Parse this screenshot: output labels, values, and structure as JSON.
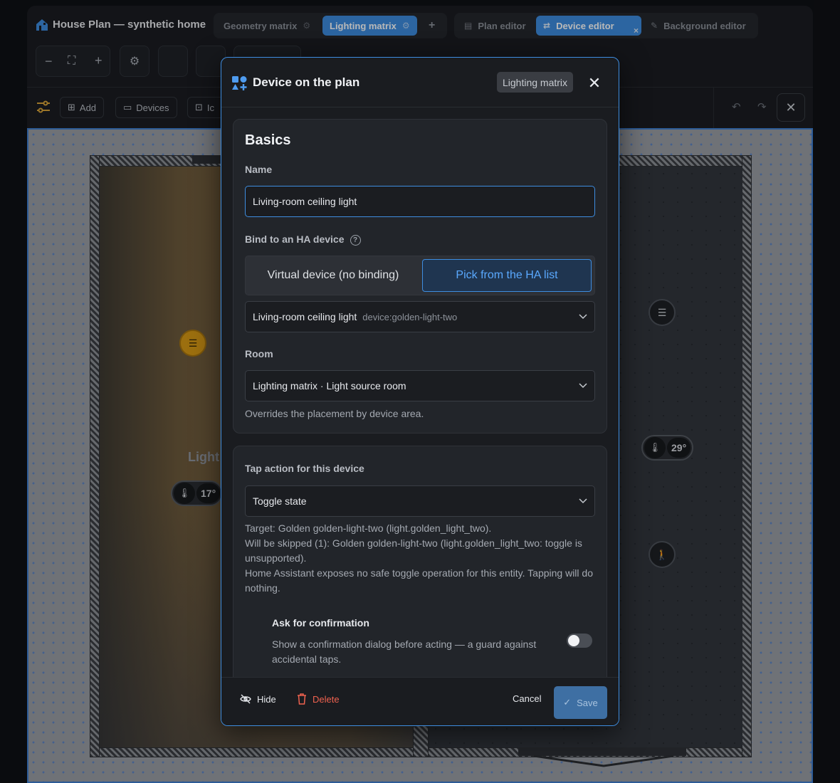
{
  "app": {
    "title": "House Plan — synthetic home",
    "plan_tabs": [
      {
        "label": "Geometry matrix",
        "active": false
      },
      {
        "label": "Lighting matrix",
        "active": true
      }
    ],
    "add_tab": "+",
    "editor_tabs": [
      {
        "label": "Plan editor",
        "active": false
      },
      {
        "label": "Device editor",
        "active": true
      },
      {
        "label": "Background editor",
        "active": false
      }
    ],
    "accent_color": "#3e8de0"
  },
  "toolbar": {
    "zoom_out": "−",
    "zoom_in": "+",
    "chips": [
      {
        "label": "Add",
        "icon": "plus-square-icon"
      },
      {
        "label": "Devices",
        "icon": "devices-icon"
      },
      {
        "label": "Ic",
        "icon": "icons-icon"
      }
    ]
  },
  "plan": {
    "room_label": "Light",
    "temp_left": "17°",
    "temp_right": "29°"
  },
  "dialog": {
    "title": "Device on the plan",
    "tag": "Lighting matrix",
    "basics": {
      "heading": "Basics",
      "name_label": "Name",
      "name_value": "Living-room ceiling light",
      "bind_label": "Bind to an HA device",
      "bind_help": "?",
      "bind_options": [
        "Virtual device (no binding)",
        "Pick from the HA list"
      ],
      "bind_selected_index": 1,
      "device_value": "Living-room ceiling light",
      "device_id": "device:golden-light-two",
      "room_label": "Room",
      "room_value": "Lighting matrix · Light source room",
      "room_hint": "Overrides the placement by device area."
    },
    "tap": {
      "label": "Tap action for this device",
      "value": "Toggle state",
      "target": "Target: Golden golden-light-two (light.golden_light_two).",
      "skipped": "Will be skipped (1): Golden golden-light-two (light.golden_light_two: toggle is unsupported).",
      "note": "Home Assistant exposes no safe toggle operation for this entity. Tapping will do nothing.",
      "confirm_title": "Ask for confirmation",
      "confirm_desc": "Show a confirmation dialog before acting — a guard against accidental taps.",
      "confirm_enabled": false
    },
    "footer": {
      "hide": "Hide",
      "delete": "Delete",
      "cancel": "Cancel",
      "save": "Save"
    }
  }
}
